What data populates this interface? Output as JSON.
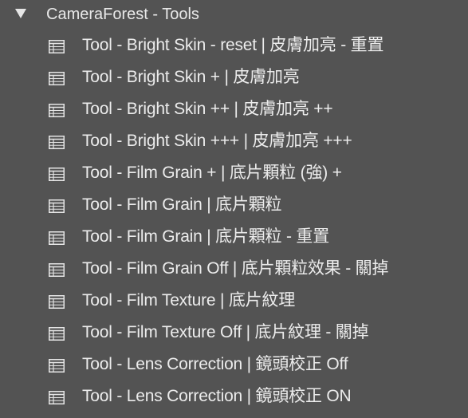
{
  "folder": {
    "label": "CameraForest - Tools",
    "expand_icon": "triangle-down-icon"
  },
  "preset_icon": "preset-list-icon",
  "items": [
    {
      "label": "Tool - Bright Skin - reset | 皮膚加亮 - 重置"
    },
    {
      "label": "Tool - Bright Skin + | 皮膚加亮"
    },
    {
      "label": "Tool - Bright Skin ++ | 皮膚加亮 ++"
    },
    {
      "label": "Tool - Bright Skin +++ | 皮膚加亮 +++"
    },
    {
      "label": "Tool - Film Grain + | 底片顆粒 (強) +"
    },
    {
      "label": "Tool - Film Grain | 底片顆粒"
    },
    {
      "label": "Tool - Film Grain | 底片顆粒 - 重置"
    },
    {
      "label": "Tool - Film Grain Off | 底片顆粒效果 - 關掉"
    },
    {
      "label": "Tool - Film Texture | 底片紋理"
    },
    {
      "label": "Tool - Film Texture Off | 底片紋理 - 關掉"
    },
    {
      "label": "Tool - Lens Correction | 鏡頭校正 Off"
    },
    {
      "label": "Tool - Lens Correction | 鏡頭校正 ON"
    }
  ]
}
